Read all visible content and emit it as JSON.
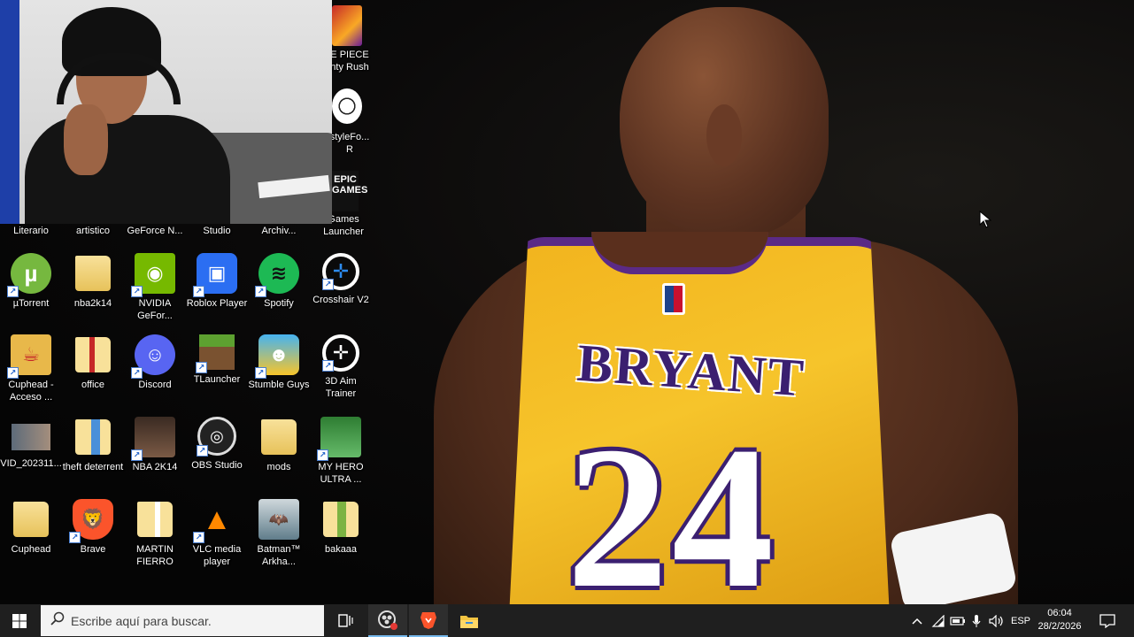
{
  "desktop": {
    "partial_top_labels": {
      "one_piece": "E PIECE\nnty Rush",
      "freestyle": "styleFo...\nR",
      "epic": "Games\nLauncher",
      "epic_logo_text": "EPIC\nGAMES"
    },
    "row0": [
      "Literario",
      "artistico",
      "GeForce N...",
      "Studio",
      "Archiv..."
    ],
    "icons": [
      {
        "label": "µTorrent"
      },
      {
        "label": "nba2k14"
      },
      {
        "label": "NVIDIA GeFor..."
      },
      {
        "label": "Roblox Player"
      },
      {
        "label": "Spotify"
      },
      {
        "label": "Crosshair V2"
      },
      {
        "label": "Cuphead - Acceso ..."
      },
      {
        "label": "office"
      },
      {
        "label": "Discord"
      },
      {
        "label": "TLauncher"
      },
      {
        "label": "Stumble Guys"
      },
      {
        "label": "3D Aim Trainer"
      },
      {
        "label": "VID_202311..."
      },
      {
        "label": "theft deterrent"
      },
      {
        "label": "NBA 2K14"
      },
      {
        "label": "OBS Studio"
      },
      {
        "label": "mods"
      },
      {
        "label": "MY HERO ULTRA ..."
      },
      {
        "label": "Cuphead"
      },
      {
        "label": "Brave"
      },
      {
        "label": "MARTIN FIERRO"
      },
      {
        "label": "VLC media player"
      },
      {
        "label": "Batman™ Arkha..."
      },
      {
        "label": "bakaaa"
      }
    ]
  },
  "wallpaper": {
    "jersey_name": "BRYANT",
    "jersey_number": "24"
  },
  "taskbar": {
    "search_placeholder": "Escribe aquí para buscar.",
    "language": "ESP",
    "time": "06:04",
    "date": "28/2/2026",
    "colors": {
      "background": "#1f1f1f",
      "accent": "#76b9ed"
    }
  }
}
